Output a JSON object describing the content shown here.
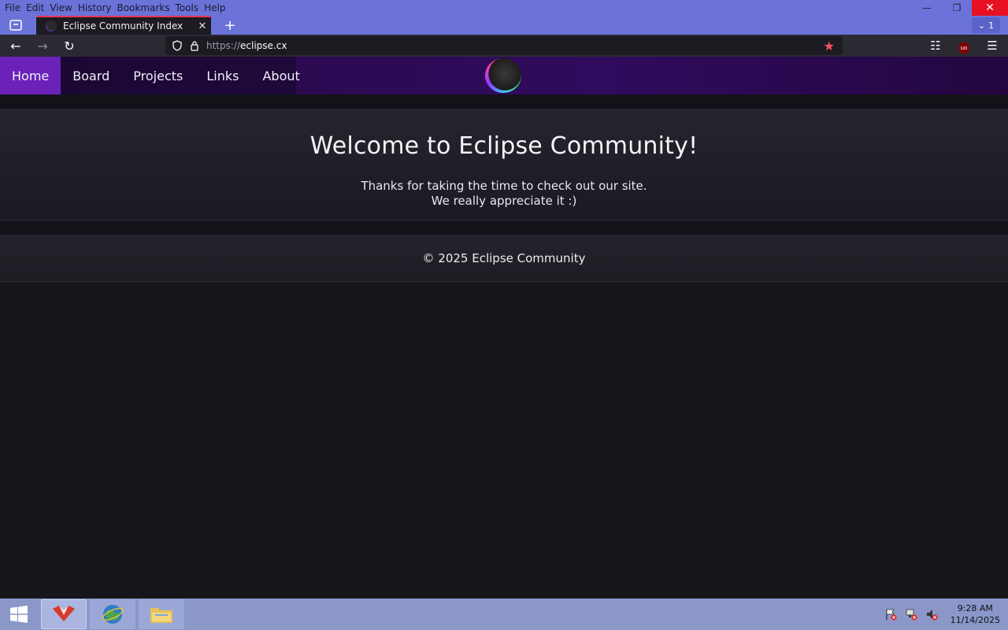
{
  "browser": {
    "menu": [
      "File",
      "Edit",
      "View",
      "History",
      "Bookmarks",
      "Tools",
      "Help"
    ],
    "tab_title": "Eclipse Community Index",
    "url_protocol": "https://",
    "url_host": "eclipse.cx",
    "tab_count": "1",
    "accent": "#6b73d9"
  },
  "site": {
    "nav": [
      "Home",
      "Board",
      "Projects",
      "Links",
      "About"
    ],
    "active_nav": "Home",
    "hero_title": "Welcome to Eclipse Community!",
    "hero_line1": "Thanks for taking the time to check out our site.",
    "hero_line2": "We really appreciate it :)",
    "footer": "© 2025 Eclipse Community"
  },
  "taskbar": {
    "time": "9:28 AM",
    "date": "11/14/2025",
    "apps": [
      "browser",
      "ie",
      "file-explorer"
    ]
  }
}
